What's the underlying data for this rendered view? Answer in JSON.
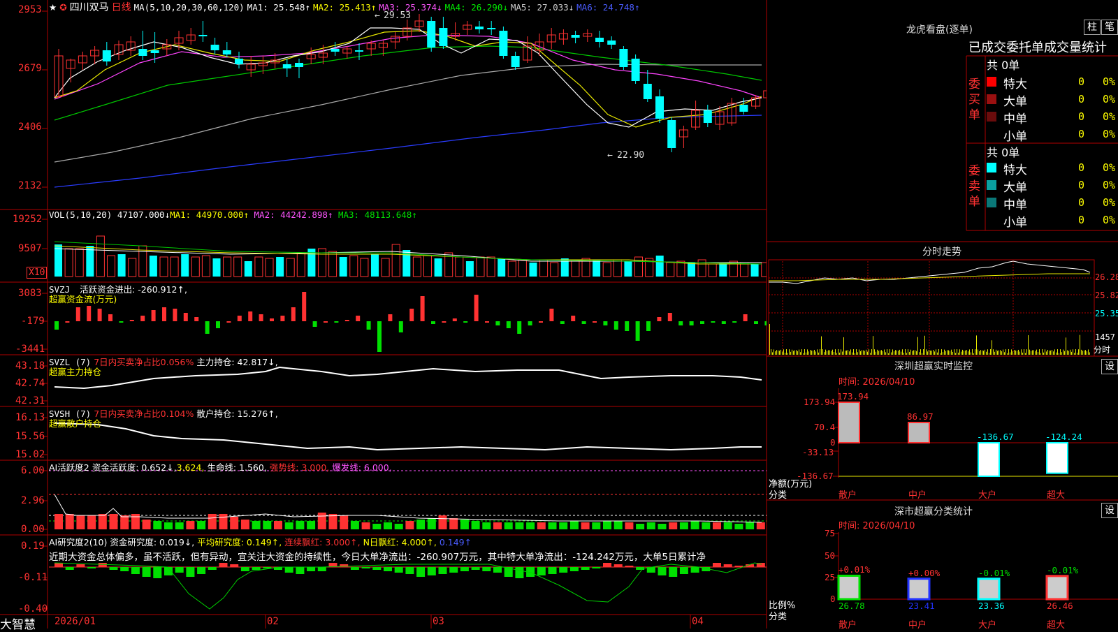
{
  "stock": {
    "name": "四川双马",
    "period": "日线",
    "star": "★",
    "flag": "✪"
  },
  "ma_legend": {
    "label": "MA(5,10,20,30,60,120)",
    "items": [
      {
        "text": "MA1: 25.548↑",
        "color": "#ffffff"
      },
      {
        "text": "MA2: 25.413↑",
        "color": "#ffff00"
      },
      {
        "text": "MA3: 25.374↓",
        "color": "#ff55ff"
      },
      {
        "text": "MA4: 26.290↓",
        "color": "#00e000"
      },
      {
        "text": "MA5: 27.033↓",
        "color": "#cccccc"
      },
      {
        "text": "MA6: 24.748↑",
        "color": "#4a5cff"
      }
    ]
  },
  "price_axis": [
    "2953",
    "2679",
    "2406",
    "2132"
  ],
  "price_annotations": {
    "high": "29.53",
    "low": "22.90"
  },
  "vol": {
    "label": "VOL(5,10,20)",
    "value": "47107.000↓",
    "ma1": "MA1: 44970.000↑",
    "ma2": "MA2: 44242.898↑",
    "ma3": "MA3: 48113.648↑",
    "axis": [
      "19252",
      "9507"
    ],
    "unit": "X10"
  },
  "svzj": {
    "label": "SVZJ",
    "sub": "活跃资金进出: -260.912↑,",
    "title": "超赢资金流(万元)",
    "axis": [
      "3083",
      "-179",
      "-3441"
    ]
  },
  "svzl": {
    "label": "SVZL (7)",
    "sub": "7日内买卖净占比0.056%",
    "sub2": "主力持仓: 42.817↓,",
    "title": "超赢主力持仓",
    "axis": [
      "43.18",
      "42.74",
      "42.31"
    ]
  },
  "svsh": {
    "label": "SVSH (7)",
    "sub": "7日内买卖净占比0.104%",
    "sub2": "散户持仓: 15.276↑,",
    "title": "超赢散户持仓",
    "axis": [
      "16.13",
      "15.56",
      "15.02"
    ]
  },
  "ai_active": {
    "label": "AI活跃度2",
    "a": "资金活跃度: 0.652↓,",
    "b": "3.624,",
    "c": "生命线: 1.560,",
    "d": "强势线: 3.000,",
    "e": "爆发线: 6.000,",
    "axis": [
      "6.00",
      "2.96",
      "0.00"
    ]
  },
  "ai_research": {
    "label": "AI研究度2(10)",
    "a": "资金研究度: 0.019↓,",
    "b": "平均研究度: 0.149↑,",
    "c": "连续飘红: 3.000↑,",
    "d": "N日飘红: 4.000↑,",
    "e": "0.149↑",
    "note": "近期大资金总体偏多，虽不活跃，但有异动，宜关注大资金的持续性，今日大单净流出：-260.907万元，其中特大单净流出：-124.242万元，大单5日累计净",
    "axis": [
      "0.19",
      "-0.11",
      "-0.40"
    ]
  },
  "xaxis": [
    "2026/01",
    "02",
    "03",
    "04"
  ],
  "brand": "大智慧",
  "right": {
    "lhb_title": "龙虎看盘(逐单)",
    "btn_zhu": "柱",
    "btn_bi": "笔",
    "stat_title": "已成交委托单成交量统计",
    "buy_label": "委买单",
    "sell_label": "委卖单",
    "buy_total": "共 0单",
    "sell_total": "共 0单",
    "buy_rows": [
      {
        "name": "特大",
        "val": "0",
        "pct": "0%",
        "color": "#ff0000"
      },
      {
        "name": "大单",
        "val": "0",
        "pct": "0%",
        "color": "#9a1010"
      },
      {
        "name": "中单",
        "val": "0",
        "pct": "0%",
        "color": "#6a0c0c"
      },
      {
        "name": "小单",
        "val": "0",
        "pct": "0%",
        "color": ""
      }
    ],
    "sell_rows": [
      {
        "name": "特大",
        "val": "0",
        "pct": "0%",
        "color": "#00ffff"
      },
      {
        "name": "大单",
        "val": "0",
        "pct": "0%",
        "color": "#0aa0a0"
      },
      {
        "name": "中单",
        "val": "0",
        "pct": "0%",
        "color": "#0a7878"
      },
      {
        "name": "小单",
        "val": "0",
        "pct": "0%",
        "color": ""
      }
    ],
    "fs_title": "分时走势",
    "fs_axis": [
      "26.28",
      "25.82",
      "25.35",
      "1457",
      "分时"
    ],
    "monitor_title": "深圳超赢实时监控",
    "set_btn": "设",
    "monitor_time": "时间: 2026/04/10",
    "monitor_axis": [
      "173.94",
      "70.4",
      "0",
      "-33.13",
      "-136.67"
    ],
    "monitor_ylabel": "净额(万元)",
    "monitor_xlabel": "分类",
    "monitor_bars": [
      {
        "cat": "散户",
        "val": "173.94"
      },
      {
        "cat": "中户",
        "val": "86.97"
      },
      {
        "cat": "大户",
        "val": "-136.67"
      },
      {
        "cat": "超大",
        "val": "-124.24"
      }
    ],
    "class_title": "深市超赢分类统计",
    "class_time": "时间: 2026/04/10",
    "class_axis": [
      "75",
      "50",
      "25",
      "0"
    ],
    "class_ylabel": "比例%",
    "class_xlabel": "分类",
    "class_bars": [
      {
        "cat": "散户",
        "pct": "+0.01%",
        "val": "26.78"
      },
      {
        "cat": "中户",
        "pct": "+0.00%",
        "val": "23.41"
      },
      {
        "cat": "大户",
        "pct": "-0.01%",
        "val": "23.36"
      },
      {
        "cat": "超大",
        "pct": "-0.01%",
        "val": "26.46"
      }
    ]
  }
}
